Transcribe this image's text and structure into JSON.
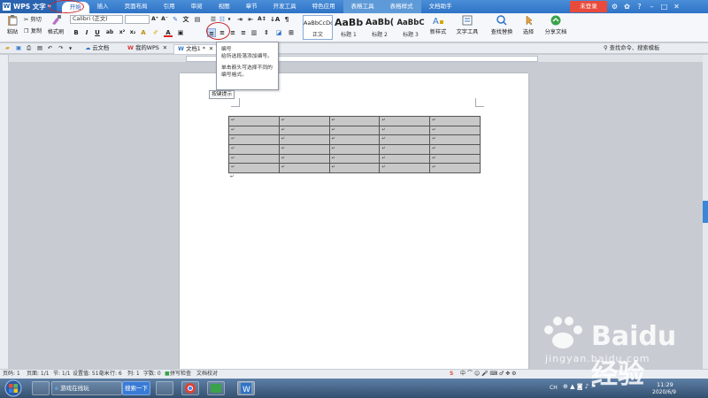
{
  "app": {
    "title": "WPS 文字"
  },
  "menu": {
    "tabs": [
      "开始",
      "插入",
      "页面布局",
      "引用",
      "审阅",
      "视图",
      "章节",
      "开发工具",
      "特色应用",
      "表格工具",
      "表格样式",
      "文档助手"
    ],
    "login": "未登录"
  },
  "ribbon": {
    "paste": "粘贴",
    "cut": "剪切",
    "copy": "复制",
    "format_painter": "格式刷",
    "font_name": "Calibri (正文)",
    "font_size": "",
    "styles": [
      {
        "sample": "AaBbCcDd",
        "name": "正文"
      },
      {
        "sample": "AaBb",
        "name": "标题 1"
      },
      {
        "sample": "AaBb(",
        "name": "标题 2"
      },
      {
        "sample": "AaBbC",
        "name": "标题 3"
      }
    ],
    "new_style": "新样式",
    "text_tools": "文字工具",
    "find_replace": "查找替换",
    "select": "选择",
    "share_doc": "分享文档"
  },
  "doctabs": {
    "cloud_doc": "云文档",
    "my_wps": "我的WPS",
    "doc1": "文档1 *",
    "search_cmd": "查找命令、搜索模板"
  },
  "tooltip": {
    "title": "编号",
    "line1": "给所选段落添加编号。",
    "line2": "单击箭头可选择不同的",
    "line3": "编号格式。",
    "subtip": "按键提示"
  },
  "table": {
    "rows": 6,
    "cols": 5,
    "cell_mark": "↵"
  },
  "statusbar": {
    "page_num": "页码: 1",
    "page": "页面: 1/1",
    "section": "节: 1/1",
    "setting": "设置值: 51毫米",
    "row": "行: 6",
    "col": "列: 1",
    "words": "字数: 0",
    "spell": "拼写检查",
    "proof": "文档校对"
  },
  "taskbar": {
    "ie_label": "游戏在线玩",
    "search_btn": "搜索一下",
    "time": "11:29",
    "date": "2020/6/9",
    "lang": "CH"
  },
  "watermark": {
    "text": "Baidu 经验",
    "url": "jingyan.baidu.com"
  },
  "colors": {
    "accent": "#2f73c6",
    "highlight_ring": "#c8262b",
    "login": "#e84b3c"
  }
}
